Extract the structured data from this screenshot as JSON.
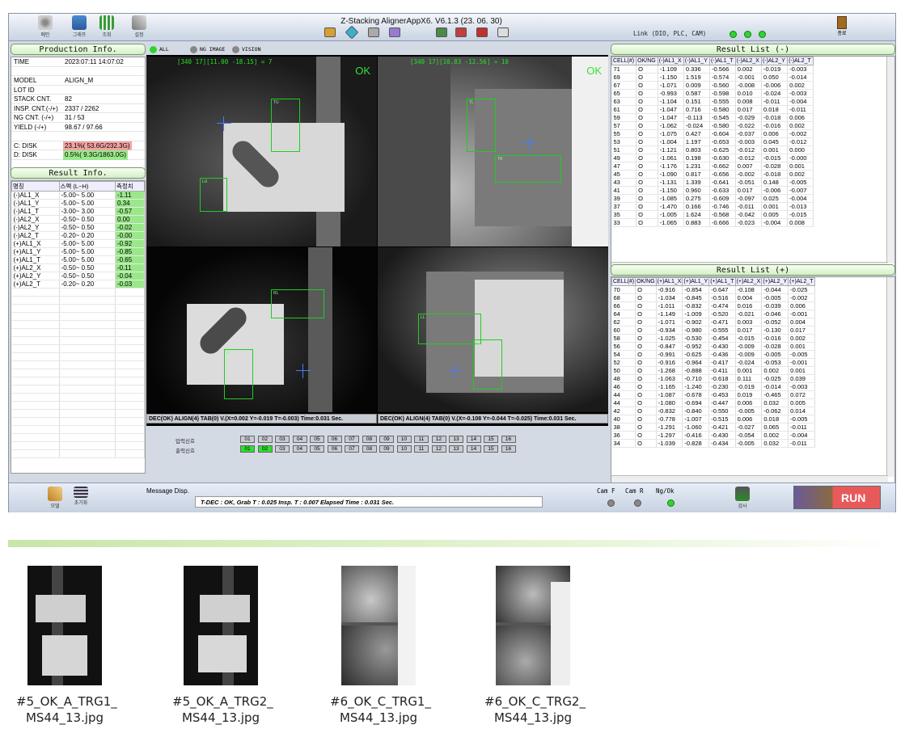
{
  "app": {
    "title": "Z-Stacking AlignerAppX6. V6.1.3 (23. 06. 30)",
    "link_label": "Link (DIO, PLC, CAM)",
    "exit_label": "종료",
    "toolbar": [
      "메인",
      "그래프",
      "조회",
      "설정"
    ]
  },
  "production": {
    "title": "Production Info.",
    "rows": [
      {
        "k": "TIME",
        "v": "2023:07:11  14:07:02"
      },
      {
        "k": "",
        "v": ""
      },
      {
        "k": "MODEL",
        "v": "ALIGN_M"
      },
      {
        "k": "LOT ID",
        "v": ""
      },
      {
        "k": "STACK CNT.",
        "v": "82"
      },
      {
        "k": "INSP. CNT.(-/+)",
        "v": "2337 / 2262"
      },
      {
        "k": "NG CNT. (-/+)",
        "v": "31 / 53"
      },
      {
        "k": "YIELD (-/+)",
        "v": "98.67 / 97.66"
      },
      {
        "k": "",
        "v": ""
      },
      {
        "k": "C: DISK",
        "v": "23.1%( 53.6G/232.3G)"
      },
      {
        "k": "D: DISK",
        "v": "0.5%( 9.3G/1863.0G)"
      }
    ],
    "c_color": "#f4a3a3",
    "d_color": "#9ae88a"
  },
  "result_info": {
    "title": "Result Info.",
    "headers": [
      "명칭",
      "스펙 (L~H)",
      "측정치"
    ],
    "rows": [
      [
        "(-)AL1_X",
        "-5.00~ 5.00",
        "-1.11"
      ],
      [
        "(-)AL1_Y",
        "-5.00~ 5.00",
        "0.34"
      ],
      [
        "(-)AL1_T",
        "-3.00~ 3.00",
        "-0.57"
      ],
      [
        "(-)AL2_X",
        "-0.50~ 0.50",
        "0.00"
      ],
      [
        "(-)AL2_Y",
        "-0.50~ 0.50",
        "-0.02"
      ],
      [
        "(-)AL2_T",
        "-0.20~ 0.20",
        "-0.00"
      ],
      [
        "(+)AL1_X",
        "-5.00~ 5.00",
        "-0.92"
      ],
      [
        "(+)AL1_Y",
        "-5.00~ 5.00",
        "-0.85"
      ],
      [
        "(+)AL1_T",
        "-5.00~ 5.00",
        "-0.65"
      ],
      [
        "(+)AL2_X",
        "-0.50~ 0.50",
        "-0.11"
      ],
      [
        "(+)AL2_Y",
        "-0.50~ 0.50",
        "-0.04"
      ],
      [
        "(+)AL2_T",
        "-0.20~ 0.20",
        "-0.03"
      ]
    ]
  },
  "center": {
    "tabs": [
      "ALL",
      "NG IMAGE",
      "VISION"
    ],
    "cam1_head": "[340  17][11.00  -18.15] = 7",
    "cam2_head": "[340  17][10.83  -12.56] = 10",
    "ok": "OK",
    "dec1": "DEC(OK) ALIGN(4) TAB(0) V.(X=0.002 Y=-0.019 T=-0.003) Time:0.031 Sec.",
    "dec2": "DEC(OK) ALIGN(4) TAB(0) V.(X=-0.108 Y=-0.044 T=-0.025) Time:0.031 Sec.",
    "input_label": "입력신호",
    "output_label": "출력신호",
    "signals": [
      "01",
      "02",
      "03",
      "04",
      "05",
      "06",
      "07",
      "08",
      "09",
      "10",
      "11",
      "12",
      "13",
      "14",
      "15",
      "16"
    ],
    "output_on": 2,
    "roi_labels": {
      "tu": "TU",
      "lu": "LU",
      "tl": "TL",
      "bl": "BL",
      "ll": "LL",
      "rl": "RL",
      "tr": "TR",
      "tb": "TB"
    }
  },
  "list_minus": {
    "title": "Result List (-)",
    "headers": [
      "CELL(#)",
      "OK/NG",
      "(-)AL1_X",
      "(-)AL1_Y",
      "(-)AL1_T",
      "(-)AL2_X",
      "(-)AL2_Y",
      "(-)AL2_T"
    ],
    "rows": [
      [
        "71",
        "O",
        "-1.109",
        "0.336",
        "-0.566",
        "0.002",
        "-0.019",
        "-0.003"
      ],
      [
        "69",
        "O",
        "-1.150",
        "1.519",
        "-0.574",
        "-0.001",
        "0.050",
        "-0.014"
      ],
      [
        "67",
        "O",
        "-1.071",
        "0.009",
        "-0.560",
        "-0.008",
        "-0.006",
        "0.002"
      ],
      [
        "65",
        "O",
        "-0.993",
        "0.587",
        "-0.598",
        "0.010",
        "-0.024",
        "-0.003"
      ],
      [
        "63",
        "O",
        "-1.104",
        "0.151",
        "-0.555",
        "0.008",
        "-0.011",
        "-0.004"
      ],
      [
        "61",
        "O",
        "-1.047",
        "0.716",
        "-0.580",
        "0.017",
        "0.018",
        "-0.011"
      ],
      [
        "59",
        "O",
        "-1.047",
        "-0.113",
        "-0.545",
        "-0.029",
        "-0.018",
        "0.006"
      ],
      [
        "57",
        "O",
        "-1.062",
        "-0.024",
        "-0.580",
        "-0.022",
        "-0.016",
        "0.002"
      ],
      [
        "55",
        "O",
        "-1.075",
        "0.427",
        "-0.604",
        "-0.037",
        "0.006",
        "-0.002"
      ],
      [
        "53",
        "O",
        "-1.004",
        "1.197",
        "-0.653",
        "-0.003",
        "0.045",
        "-0.012"
      ],
      [
        "51",
        "O",
        "-1.121",
        "0.803",
        "-0.625",
        "-0.012",
        "0.001",
        "0.000"
      ],
      [
        "49",
        "O",
        "-1.061",
        "0.198",
        "-0.630",
        "-0.012",
        "-0.015",
        "-0.000"
      ],
      [
        "47",
        "O",
        "-1.176",
        "1.231",
        "-0.662",
        "0.007",
        "-0.028",
        "0.001"
      ],
      [
        "45",
        "O",
        "-1.090",
        "0.817",
        "-0.656",
        "-0.002",
        "-0.018",
        "0.002"
      ],
      [
        "43",
        "O",
        "-1.131",
        "1.339",
        "-0.641",
        "-0.051",
        "0.148",
        "-0.005"
      ],
      [
        "41",
        "O",
        "-1.150",
        "0.960",
        "-0.633",
        "0.017",
        "-0.006",
        "-0.007"
      ],
      [
        "39",
        "O",
        "-1.085",
        "0.275",
        "-0.609",
        "-0.097",
        "0.025",
        "-0.004"
      ],
      [
        "37",
        "O",
        "-1.470",
        "0.166",
        "-0.746",
        "-0.011",
        "0.001",
        "-0.013"
      ],
      [
        "35",
        "O",
        "-1.005",
        "1.624",
        "-0.568",
        "-0.042",
        "0.005",
        "-0.015"
      ],
      [
        "33",
        "O",
        "-1.065",
        "0.883",
        "-0.666",
        "-0.023",
        "-0.004",
        "0.008"
      ]
    ]
  },
  "list_plus": {
    "title": "Result List (+)",
    "headers": [
      "CELL(#)",
      "OK/NG",
      "(+)AL1_X",
      "(+)AL1_Y",
      "(+)AL1_T",
      "(+)AL2_X",
      "(+)AL2_Y",
      "(+)AL2_T"
    ],
    "rows": [
      [
        "70",
        "O",
        "-0.916",
        "-0.854",
        "-0.647",
        "-0.108",
        "-0.044",
        "-0.025"
      ],
      [
        "68",
        "O",
        "-1.034",
        "-0.845",
        "-0.516",
        "0.004",
        "-0.005",
        "-0.002"
      ],
      [
        "66",
        "O",
        "-1.011",
        "-0.832",
        "-0.474",
        "0.016",
        "-0.039",
        "0.006"
      ],
      [
        "64",
        "O",
        "-1.149",
        "-1.009",
        "-0.520",
        "-0.021",
        "-0.046",
        "-0.001"
      ],
      [
        "62",
        "O",
        "-1.071",
        "-0.902",
        "-0.471",
        "0.003",
        "-0.052",
        "0.004"
      ],
      [
        "60",
        "O",
        "-0.934",
        "-0.980",
        "-0.555",
        "0.017",
        "-0.130",
        "0.017"
      ],
      [
        "58",
        "O",
        "-1.025",
        "-0.530",
        "-0.454",
        "-0.015",
        "-0.016",
        "0.002"
      ],
      [
        "56",
        "O",
        "-0.847",
        "-0.952",
        "-0.430",
        "-0.009",
        "-0.028",
        "0.001"
      ],
      [
        "54",
        "O",
        "-0.991",
        "-0.625",
        "-0.436",
        "-0.009",
        "-0.005",
        "-0.005"
      ],
      [
        "52",
        "O",
        "-0.916",
        "-0.964",
        "-0.417",
        "-0.024",
        "-0.053",
        "-0.001"
      ],
      [
        "50",
        "O",
        "-1.268",
        "-0.888",
        "-0.411",
        "0.001",
        "0.002",
        "0.001"
      ],
      [
        "48",
        "O",
        "-1.063",
        "-0.710",
        "-0.618",
        "0.111",
        "-0.025",
        "0.039"
      ],
      [
        "46",
        "O",
        "-1.165",
        "-1.240",
        "-0.230",
        "-0.019",
        "-0.014",
        "-0.003"
      ],
      [
        "44",
        "O",
        "-1.087",
        "-0.678",
        "-0.453",
        "0.019",
        "-0.465",
        "0.072"
      ],
      [
        "44",
        "O",
        "-1.080",
        "-0.694",
        "-0.447",
        "0.006",
        "0.032",
        "0.005"
      ],
      [
        "42",
        "O",
        "-0.832",
        "-0.840",
        "-0.550",
        "-0.005",
        "-0.062",
        "0.014"
      ],
      [
        "40",
        "O",
        "-0.778",
        "-1.007",
        "-0.515",
        "0.006",
        "0.018",
        "-0.005"
      ],
      [
        "38",
        "O",
        "-1.291",
        "-1.060",
        "-0.421",
        "-0.027",
        "0.065",
        "-0.011"
      ],
      [
        "36",
        "O",
        "-1.297",
        "-0.416",
        "-0.430",
        "-0.054",
        "0.002",
        "-0.004"
      ],
      [
        "34",
        "O",
        "-1.039",
        "-0.828",
        "-0.434",
        "-0.005",
        "0.032",
        "-0.011"
      ]
    ]
  },
  "bottom": {
    "btn1": "모델",
    "btn2": "초기화",
    "msg_label": "Message Disp.",
    "message": "T-DEC : OK,  Grab T : 0.025  Insp. T : 0.007  Elapsed Time : 0.031 Sec.",
    "camf": "Cam F",
    "camr": "Cam R",
    "ngok": "Ng/Ok",
    "inspect": "검사",
    "run": "RUN"
  },
  "files": [
    "#5_OK_A_TRG1_\nMS44_13.jpg",
    "#5_OK_A_TRG2_\nMS44_13.jpg",
    "#6_OK_C_TRG1_\nMS44_13.jpg",
    "#6_OK_C_TRG2_\nMS44_13.jpg"
  ]
}
